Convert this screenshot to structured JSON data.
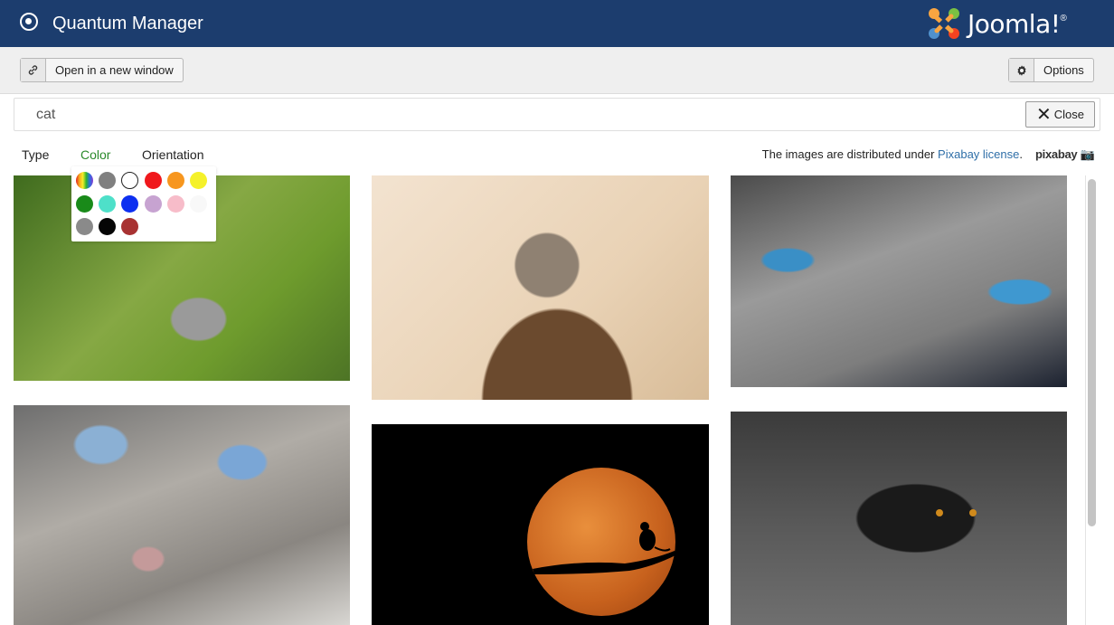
{
  "header": {
    "title": "Quantum Manager",
    "logo_text": "Joomla!",
    "logo_colors": [
      "#f44321",
      "#f9a541",
      "#7ac143",
      "#5091cd"
    ]
  },
  "toolbar": {
    "open_label": "Open in a new window",
    "open_icon": "link-icon",
    "options_label": "Options",
    "options_icon": "gear-icon"
  },
  "search": {
    "value": "cat",
    "close_label": "Close"
  },
  "filters": {
    "type_label": "Type",
    "color_label": "Color",
    "orientation_label": "Orientation",
    "active": "Color"
  },
  "license": {
    "prefix": "The images are distributed under ",
    "link": "Pixabay license",
    "suffix": ".",
    "brand": "pixabay"
  },
  "color_palette": [
    {
      "name": "rainbow",
      "color": "multicolor"
    },
    {
      "name": "grey",
      "color": "#808080"
    },
    {
      "name": "transparent",
      "color": "#ffffff",
      "selected": true
    },
    {
      "name": "red",
      "color": "#f0181c"
    },
    {
      "name": "orange",
      "color": "#f7961e"
    },
    {
      "name": "yellow",
      "color": "#f5f12a"
    },
    {
      "name": "green",
      "color": "#198a19"
    },
    {
      "name": "turquoise",
      "color": "#4ee0c9"
    },
    {
      "name": "blue",
      "color": "#0d2ff0"
    },
    {
      "name": "lilac",
      "color": "#c7a3d1"
    },
    {
      "name": "pink",
      "color": "#f7bcc9"
    },
    {
      "name": "white",
      "color": "#f8f8f8"
    },
    {
      "name": "gray",
      "color": "#8a8a8a"
    },
    {
      "name": "black",
      "color": "#060606"
    },
    {
      "name": "brown",
      "color": "#a83232"
    }
  ],
  "images": [
    {
      "name": "kitten-sitting-in-grass"
    },
    {
      "name": "kitten-looking-up"
    },
    {
      "name": "cat-blue-eyes-closeup"
    },
    {
      "name": "cat-face-blue-eyes"
    },
    {
      "name": "cat-silhouette-moon"
    },
    {
      "name": "black-cat-lying"
    }
  ]
}
